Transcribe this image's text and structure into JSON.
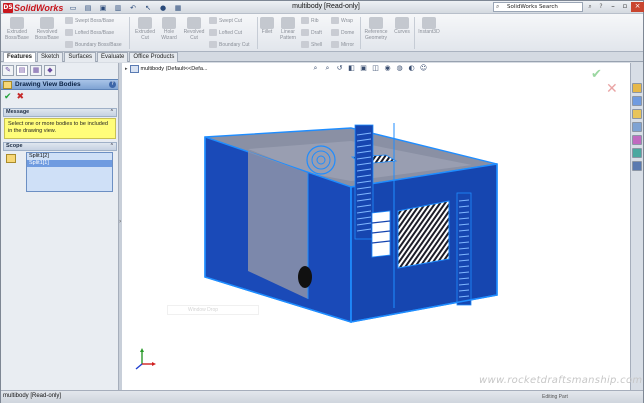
{
  "app": {
    "logo_badge": "DS",
    "logo_text": "SolidWorks",
    "window_title": "multibody [Read-only]",
    "search_placeholder": "SolidWorks Search",
    "colors": {
      "accent": "#7fa3d3",
      "brand": "#c8161d",
      "model": "#1846b8",
      "edge": "#1f8dff"
    }
  },
  "commands": {
    "extruded_boss": "Extruded\nBoss/Base",
    "revolved_boss": "Revolved\nBoss/Base",
    "swept_boss": "Swept Boss/Base",
    "lofted_boss": "Lofted Boss/Base",
    "boundary_boss": "Boundary Boss/Base",
    "extruded_cut": "Extruded\nCut",
    "hole_wizard": "Hole\nWizard",
    "revolved_cut": "Revolved\nCut",
    "swept_cut": "Swept Cut",
    "lofted_cut": "Lofted Cut",
    "boundary_cut": "Boundary Cut",
    "fillet": "Fillet",
    "linear_pattern": "Linear\nPattern",
    "rib": "Rib",
    "draft": "Draft",
    "shell": "Shell",
    "wrap": "Wrap",
    "dome": "Dome",
    "mirror": "Mirror",
    "reference_geometry": "Reference\nGeometry",
    "curves": "Curves",
    "instant3d": "Instant3D"
  },
  "tabs": [
    "Features",
    "Sketch",
    "Surfaces",
    "Evaluate",
    "Office Products"
  ],
  "property_manager": {
    "title": "Drawing View Bodies",
    "message_header": "Message",
    "message_text": "Select one or more bodies to be included in the drawing view.",
    "scope_header": "Scope",
    "scope_items": [
      "Split1[2]",
      "Split1[1]"
    ],
    "selected_index": 1
  },
  "graphics": {
    "tree_label": "multibody (Default<<Defa...",
    "watermark": "Window Drop"
  },
  "status": {
    "text": "multibody [Read-only]",
    "right_text": "Editing Part"
  },
  "watermark_site": "www.rocketdraftsmanship.com"
}
